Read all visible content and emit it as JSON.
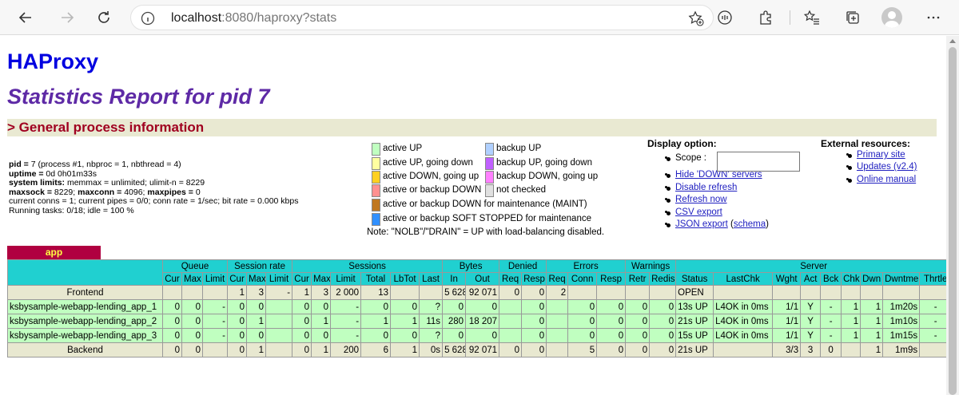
{
  "browser": {
    "url_host": "localhost",
    "url_rest": ":8080/haproxy?stats"
  },
  "page": {
    "brand": "HAProxy",
    "report_title": "Statistics Report for pid 7",
    "section_title": "> General process information"
  },
  "procinfo": {
    "line1_label": "pid =",
    "line1_value": " 7 (process #1, nbproc = 1, nbthread = 4)",
    "line2_label": "uptime =",
    "line2_value": " 0d 0h01m33s",
    "line3_label": "system limits:",
    "line3_value": " memmax = unlimited; ulimit-n = 8229",
    "line4_label1": "maxsock =",
    "line4_value1": " 8229; ",
    "line4_label2": "maxconn =",
    "line4_value2": " 4096; ",
    "line4_label3": "maxpipes =",
    "line4_value3": " 0",
    "line5": "current conns = 1; current pipes = 0/0; conn rate = 1/sec; bit rate = 0.000 kbps",
    "line6": "Running tasks: 0/18; idle = 100 %"
  },
  "legend": {
    "items": [
      {
        "text": "active UP",
        "color": "#c0ffc0"
      },
      {
        "text": "active UP, going down",
        "color": "#ffffa0"
      },
      {
        "text": "active DOWN, going up",
        "color": "#ffd020"
      },
      {
        "text": "active or backup DOWN",
        "color": "#ff9090"
      },
      {
        "text": "active or backup DOWN for maintenance (MAINT)",
        "color": "#c07820"
      },
      {
        "text": "active or backup SOFT STOPPED for maintenance",
        "color": "#3090ff"
      },
      {
        "text": "backup UP",
        "color": "#b0d0ff"
      },
      {
        "text": "backup UP, going down",
        "color": "#c060ff"
      },
      {
        "text": "backup DOWN, going up",
        "color": "#ff80ff"
      },
      {
        "text": "not checked",
        "color": "#e0e0e0"
      }
    ],
    "note": "Note: \"NOLB\"/\"DRAIN\" = UP with load-balancing disabled."
  },
  "display": {
    "title": "Display option:",
    "scope_label": "Scope :",
    "links": [
      "Hide 'DOWN' servers",
      "Disable refresh",
      "Refresh now",
      "CSV export",
      "JSON export"
    ],
    "schema_open": " (",
    "schema_link": "schema",
    "schema_close": ")"
  },
  "external": {
    "title": "External resources:",
    "links": [
      "Primary site",
      "Updates (v2.4)",
      "Online manual"
    ]
  },
  "stats": {
    "proxy_name": "app",
    "groups": [
      "Queue",
      "Session rate",
      "Sessions",
      "Bytes",
      "Denied",
      "Errors",
      "Warnings",
      "Server"
    ],
    "columns": [
      "Cur",
      "Max",
      "Limit",
      "Cur",
      "Max",
      "Limit",
      "Cur",
      "Max",
      "Limit",
      "Total",
      "LbTot",
      "Last",
      "In",
      "Out",
      "Req",
      "Resp",
      "Req",
      "Conn",
      "Resp",
      "Retr",
      "Redis",
      "Status",
      "LastChk",
      "Wght",
      "Act",
      "Bck",
      "Chk",
      "Dwn",
      "Dwntme",
      "Thrtle"
    ],
    "frontend": [
      "Frontend",
      "",
      "",
      "",
      "1",
      "3",
      "-",
      "1",
      "3",
      "2 000",
      "13",
      "",
      "",
      "5 628",
      "92 071",
      "0",
      "0",
      "2",
      "",
      "",
      "",
      "",
      "OPEN",
      "",
      "",
      "",
      "",
      "",
      "",
      "",
      ""
    ],
    "servers": [
      [
        "ksbysample-webapp-lending_app_1",
        "0",
        "0",
        "-",
        "0",
        "0",
        "",
        "0",
        "0",
        "-",
        "0",
        "0",
        "?",
        "0",
        "0",
        "",
        "0",
        "",
        "0",
        "0",
        "0",
        "0",
        "13s UP",
        "L4OK in 0ms",
        "1/1",
        "Y",
        "-",
        "1",
        "1",
        "1m20s",
        "-"
      ],
      [
        "ksbysample-webapp-lending_app_2",
        "0",
        "0",
        "-",
        "0",
        "1",
        "",
        "0",
        "1",
        "-",
        "1",
        "1",
        "11s",
        "280",
        "18 207",
        "",
        "0",
        "",
        "0",
        "0",
        "0",
        "0",
        "21s UP",
        "L4OK in 0ms",
        "1/1",
        "Y",
        "-",
        "1",
        "1",
        "1m10s",
        "-"
      ],
      [
        "ksbysample-webapp-lending_app_3",
        "0",
        "0",
        "-",
        "0",
        "0",
        "",
        "0",
        "0",
        "-",
        "0",
        "0",
        "?",
        "0",
        "0",
        "",
        "0",
        "",
        "0",
        "0",
        "0",
        "0",
        "15s UP",
        "L4OK in 0ms",
        "1/1",
        "Y",
        "-",
        "1",
        "1",
        "1m15s",
        "-"
      ]
    ],
    "backend": [
      "Backend",
      "0",
      "0",
      "",
      "0",
      "1",
      "",
      "0",
      "1",
      "200",
      "6",
      "1",
      "0s",
      "5 628",
      "92 071",
      "0",
      "0",
      "",
      "5",
      "0",
      "0",
      "0",
      "21s UP",
      "",
      "3/3",
      "3",
      "0",
      "",
      "1",
      "1m9s",
      ""
    ]
  }
}
